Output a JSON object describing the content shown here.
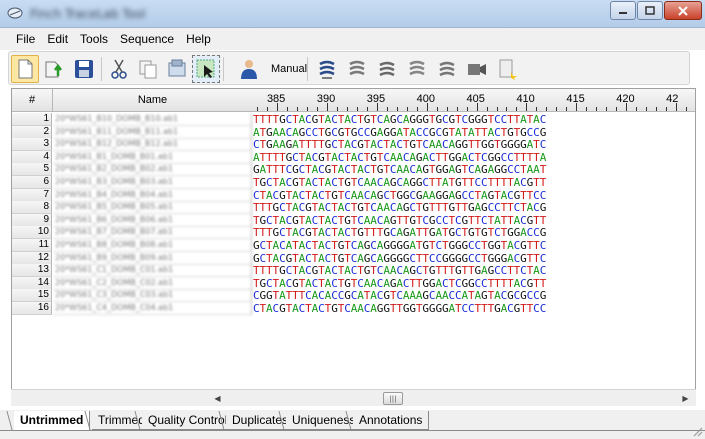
{
  "window": {
    "title": "Finch TraceLab Tool",
    "controls": [
      "minimize",
      "maximize",
      "close"
    ]
  },
  "menu": [
    "File",
    "Edit",
    "Tools",
    "Sequence",
    "Help"
  ],
  "toolbar": {
    "manual_label": "Manual",
    "icons": [
      "new-file-icon",
      "open-icon",
      "save-icon",
      "cut-icon",
      "copy-icon",
      "paste-icon",
      "select-icon",
      "manual-user-icon",
      "trim-icon-1",
      "trim-icon-2",
      "trim-icon-3",
      "trim-icon-4",
      "trim-icon-5",
      "camera-icon",
      "notes-icon"
    ]
  },
  "grid": {
    "columns": {
      "number": "#",
      "name": "Name"
    },
    "ruler": {
      "start": 383,
      "labels": [
        385,
        390,
        395,
        400,
        405,
        410,
        415,
        420,
        425
      ],
      "visible_label_text": [
        "385",
        "390",
        "395",
        "400",
        "405",
        "410",
        "415",
        "420",
        "42"
      ]
    },
    "rows": [
      {
        "num": "1",
        "name": "20*WS61_B10_DOMB_B10.ab1",
        "seq": "TTTTGCTACGTACTACTGTCAGCAGGGTGCGTCGGGTCCTTATAC"
      },
      {
        "num": "2",
        "name": "20*WS61_B11_DOMB_B11.ab1",
        "seq": "ATGAACAGCCTGCGTGCCGAGGATACCGCGTATATTACTGTGCCG"
      },
      {
        "num": "3",
        "name": "20*WS61_B12_DOMB_B12.ab1",
        "seq": "CTGAAGATTTTGCTACGTACTACTGTCAACAGGTTGGTGGGGATC"
      },
      {
        "num": "4",
        "name": "20*WS61_B1_DOMB_B01.ab1",
        "seq": "ATTTTGCTACGTACTACTGTCAACAGACTTGGACTCGGCCTTTTA"
      },
      {
        "num": "5",
        "name": "20*WS61_B2_DOMB_B02.ab1",
        "seq": "GATTTCGCTACGTACTACTGTCAACAGTGGAGTCAGAGGCCTAAT"
      },
      {
        "num": "6",
        "name": "20*WS61_B3_DOMB_B03.ab1",
        "seq": "TGCTACGTACTACTGTCAACAGCAGGCTTATGTTCCTTTTACGTT"
      },
      {
        "num": "7",
        "name": "20*WS61_B4_DOMB_B04.ab1",
        "seq": "CTACGTACTACTGTCAACAGCTGGCGAAGGAGCCTAGTACGTTCC"
      },
      {
        "num": "8",
        "name": "20*WS61_B5_DOMB_B05.ab1",
        "seq": "TTTGCTACGTACTACTGTCAACAGCTGTTTGTTGAGCCTTCTACG"
      },
      {
        "num": "9",
        "name": "20*WS61_B6_DOMB_B06.ab1",
        "seq": "TGCTACGTACTACTGTCAACAGTTGTCGCCTCGTTCTATTACGTT"
      },
      {
        "num": "10",
        "name": "20*WS61_B7_DOMB_B07.ab1",
        "seq": "TTTGCTACGTACTACTGTTTGCAGATTGATGCTGTGTCTGGACCG"
      },
      {
        "num": "11",
        "name": "20*WS61_B8_DOMB_B08.ab1",
        "seq": "GCTACATACTACTGTCAGCAGGGGATGTCTGGGCCTGGTACGTTC"
      },
      {
        "num": "12",
        "name": "20*WS61_B9_DOMB_B09.ab1",
        "seq": "GCTACGTACTACTGTCAGCAGGGGCTTCCGGGGCCTGGGACGTTC"
      },
      {
        "num": "13",
        "name": "20*WS61_C1_DOMB_C01.ab1",
        "seq": "TTTTGCTACGTACTACTGTCAACAGCTGTTTGTTGAGCCTTCTAC"
      },
      {
        "num": "14",
        "name": "20*WS61_C2_DOMB_C02.ab1",
        "seq": "TGCTACGTACTACTGTCAACAGACTTGGACTCGGCCTTTTACGTT"
      },
      {
        "num": "15",
        "name": "20*WS61_C3_DOMB_C03.ab1",
        "seq": "CGGTATTTCACACCGCATACGTCAAAGCAACCATAGTACGCGCCG"
      },
      {
        "num": "16",
        "name": "20*WS61_C4_DOMB_C04.ab1",
        "seq": "CTACGTACTACTGTCAACAGGTTGGTGGGGATCCTTTGACGTTCC"
      }
    ]
  },
  "base_colors": {
    "A": "#1a9a1a",
    "C": "#1a2cd6",
    "G": "#111111",
    "T": "#d21a1a"
  },
  "tabs": [
    "Untrimmed",
    "Trimmed",
    "Quality Control",
    "Duplicates",
    "Uniqueness",
    "Annotations"
  ],
  "active_tab": "Untrimmed"
}
